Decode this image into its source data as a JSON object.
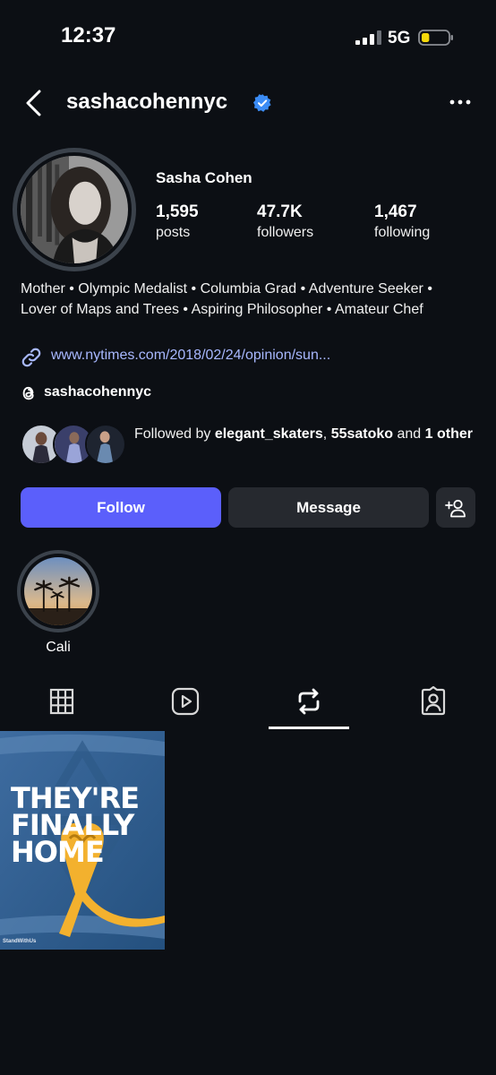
{
  "status_bar": {
    "time": "12:37",
    "network": "5G",
    "battery_level": 0.3,
    "battery_color": "#f5d90a"
  },
  "header": {
    "username": "sashacohennyc",
    "verified": true,
    "verified_color": "#3b8cf5",
    "back_icon": "chevron-left-icon",
    "more_icon": "more-horizontal-icon"
  },
  "profile": {
    "display_name": "Sasha Cohen",
    "stats": [
      {
        "value": "1,595",
        "label": "posts"
      },
      {
        "value": "47.7K",
        "label": "followers"
      },
      {
        "value": "1,467",
        "label": "following"
      }
    ],
    "bio": "Mother • Olympic Medalist • Columbia Grad • Adventure Seeker • Lover of Maps and Trees • Aspiring Philosopher • Amateur Chef",
    "link": "www.nytimes.com/2018/02/24/opinion/sun...",
    "threads_handle": "sashacohennyc"
  },
  "followed_by": {
    "prefix": "Followed by ",
    "users": [
      "elegant_skaters",
      "55satoko"
    ],
    "separator": ", ",
    "and_text": " and ",
    "others": "1 other"
  },
  "actions": {
    "follow_label": "Follow",
    "message_label": "Message",
    "follow_color": "#5b5ffb"
  },
  "highlights": [
    {
      "label": "Cali"
    }
  ],
  "tabs": [
    {
      "name": "grid",
      "icon": "grid-icon",
      "active": false
    },
    {
      "name": "reels",
      "icon": "reels-icon",
      "active": false
    },
    {
      "name": "reposts",
      "icon": "repost-icon",
      "active": true
    },
    {
      "name": "tagged",
      "icon": "tagged-person-icon",
      "active": false
    }
  ],
  "posts": [
    {
      "text": "THEY'RE FINALLY HOME",
      "caption": "StandWithUs"
    }
  ]
}
